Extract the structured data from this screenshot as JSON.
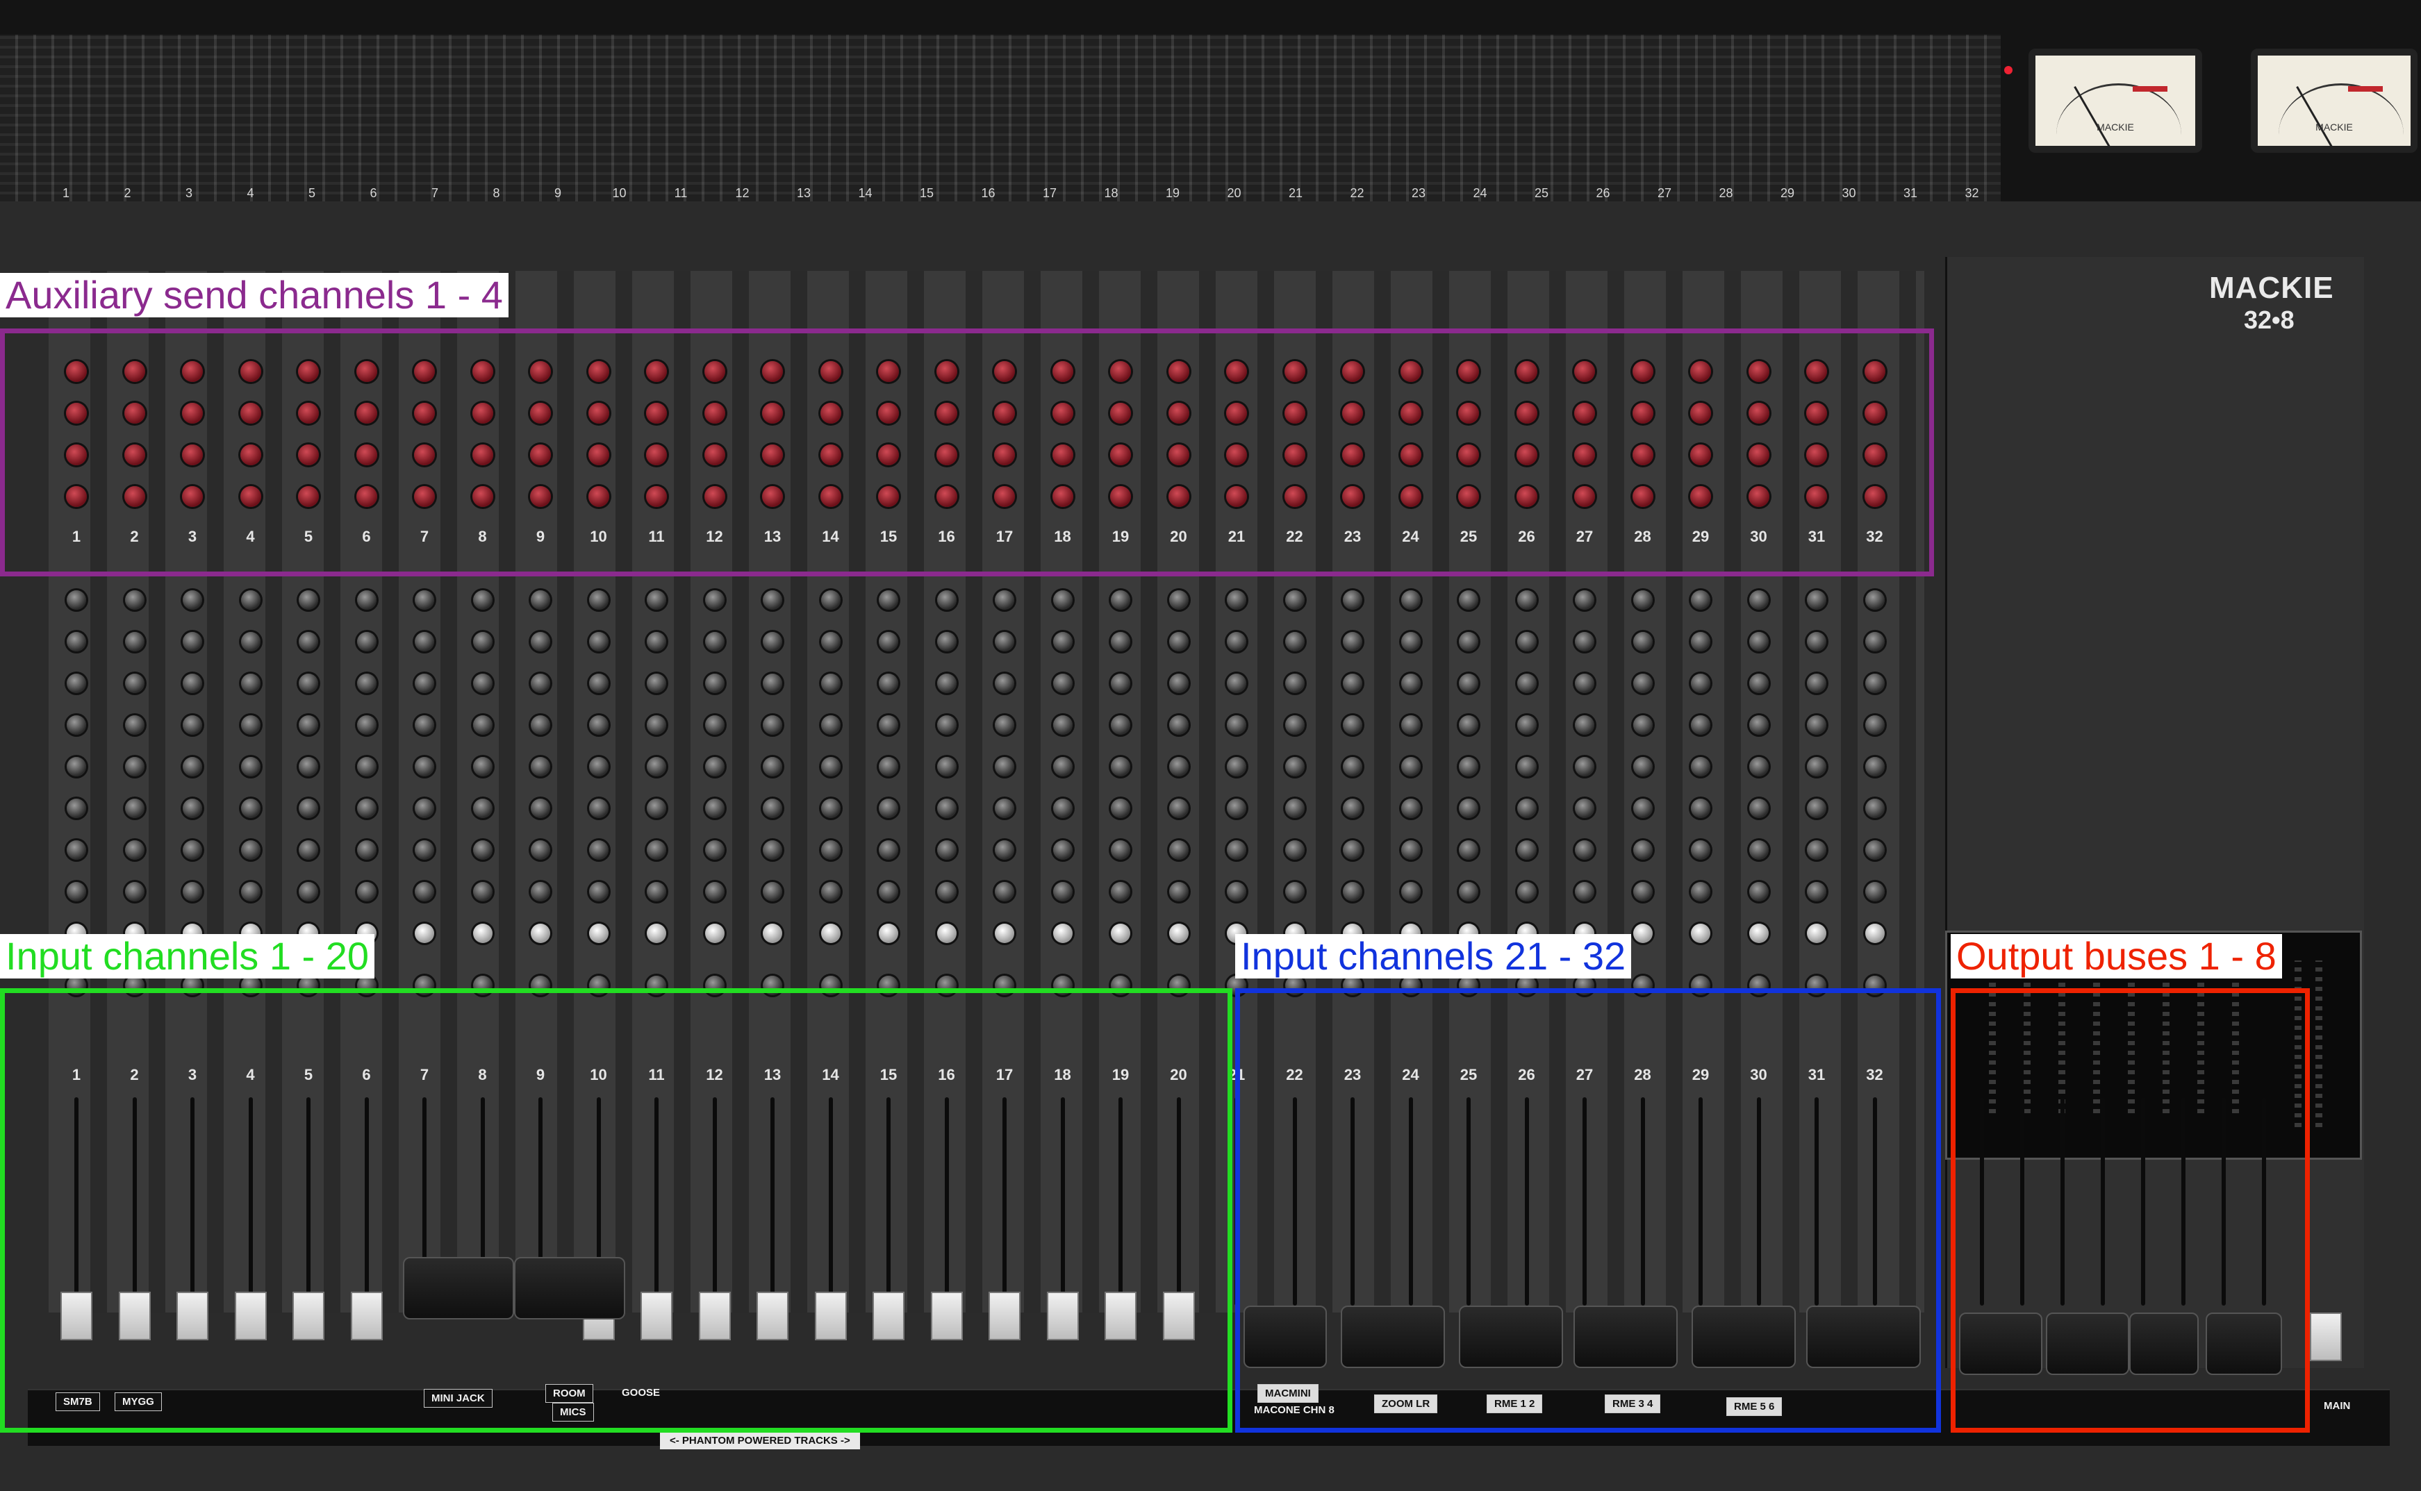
{
  "annotations": {
    "aux": {
      "label": "Auxiliary send channels 1 - 4",
      "color": "#8b2a8e"
    },
    "in1": {
      "label": "Input channels 1 - 20",
      "color": "#22dd22"
    },
    "in2": {
      "label": "Input channels 21 - 32",
      "color": "#1133dd"
    },
    "out": {
      "label": "Output buses 1 - 8",
      "color": "#ee2200"
    }
  },
  "brand": {
    "name": "MACKIE",
    "model": "32•8"
  },
  "meter_bridge": {
    "numbers": [
      "1",
      "2",
      "3",
      "4",
      "5",
      "6",
      "7",
      "8",
      "9",
      "10",
      "11",
      "12",
      "13",
      "14",
      "15",
      "16",
      "17",
      "18",
      "19",
      "20",
      "21",
      "22",
      "23",
      "24",
      "25",
      "26",
      "27",
      "28",
      "29",
      "30",
      "31",
      "32"
    ]
  },
  "strips": {
    "numbers": [
      "1",
      "2",
      "3",
      "4",
      "5",
      "6",
      "7",
      "8",
      "9",
      "10",
      "11",
      "12",
      "13",
      "14",
      "15",
      "16",
      "17",
      "18",
      "19",
      "20",
      "21",
      "22",
      "23",
      "24",
      "25",
      "26",
      "27",
      "28",
      "29",
      "30",
      "31",
      "32"
    ]
  },
  "scribble_strip": {
    "labels": [
      "SM7B",
      "MYGG",
      "MINI JACK",
      "ROOM",
      "MICS",
      "GOOSE",
      "MACMINI",
      "MACONE CHN 8",
      "ZOOM LR",
      "RME 1 2",
      "RME 3 4",
      "RME 5 6",
      "MAIN"
    ]
  },
  "phantom_label": "<- PHANTOM POWERED TRACKS ->",
  "colors": {
    "console": "#2b2b2b",
    "fader_cap": "#e0e0e0",
    "red_knob": "#8b1a24"
  }
}
